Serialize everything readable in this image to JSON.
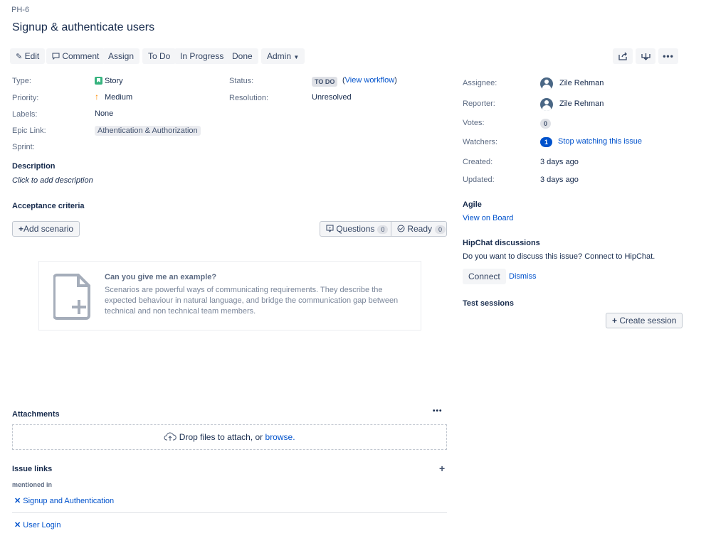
{
  "issue": {
    "key": "PH-6",
    "title": "Signup & authenticate users"
  },
  "toolbar": {
    "edit": "Edit",
    "comment": "Comment",
    "assign": "Assign",
    "todo": "To Do",
    "in_progress": "In Progress",
    "done": "Done",
    "admin": "Admin"
  },
  "details": {
    "type_label": "Type:",
    "type_value": "Story",
    "priority_label": "Priority:",
    "priority_value": "Medium",
    "labels_label": "Labels:",
    "labels_value": "None",
    "epic_label": "Epic Link:",
    "epic_value": "Athentication & Authorization",
    "sprint_label": "Sprint:",
    "status_label": "Status:",
    "status_value": "TO DO",
    "view_workflow_open": "(",
    "view_workflow": "View workflow",
    "view_workflow_close": ")",
    "resolution_label": "Resolution:",
    "resolution_value": "Unresolved"
  },
  "description": {
    "heading": "Description",
    "placeholder": "Click to add description"
  },
  "acceptance": {
    "heading": "Acceptance criteria",
    "add_scenario": "Add scenario",
    "questions": "Questions",
    "questions_count": "0",
    "ready": "Ready",
    "ready_count": "0",
    "example_title": "Can you give me an example?",
    "example_text": "Scenarios are powerful ways of communicating requirements. They describe the expected behaviour in natural language, and bridge the communication gap between technical and non technical team members."
  },
  "attachments": {
    "heading": "Attachments",
    "drop_text": "Drop files to attach, or",
    "browse": "browse."
  },
  "issue_links": {
    "heading": "Issue links",
    "group": "mentioned in",
    "items": [
      "Signup and Authentication",
      "User Login"
    ]
  },
  "people": {
    "assignee_label": "Assignee:",
    "assignee": "Zile Rehman",
    "reporter_label": "Reporter:",
    "reporter": "Zile Rehman",
    "votes_label": "Votes:",
    "votes": "0",
    "watchers_label": "Watchers:",
    "watchers": "1",
    "stop_watching": "Stop watching this issue"
  },
  "dates": {
    "created_label": "Created:",
    "created": "3 days ago",
    "updated_label": "Updated:",
    "updated": "3 days ago"
  },
  "agile": {
    "heading": "Agile",
    "view_on_board": "View on Board"
  },
  "hipchat": {
    "heading": "HipChat discussions",
    "text": "Do you want to discuss this issue? Connect to HipChat.",
    "connect": "Connect",
    "dismiss": "Dismiss"
  },
  "test_sessions": {
    "heading": "Test sessions",
    "create": "Create session"
  },
  "colors": {
    "link": "#0052cc",
    "story": "#36b37e",
    "priority": "#ff8b00"
  }
}
